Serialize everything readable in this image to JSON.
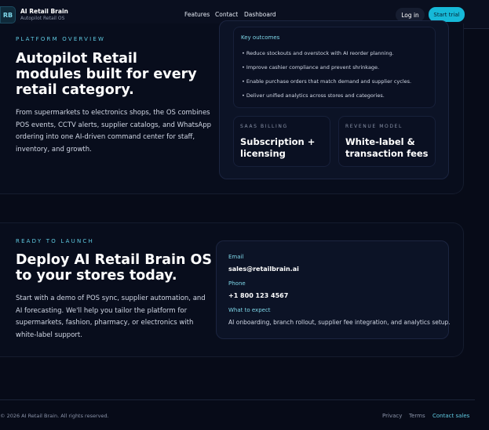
{
  "nav": {
    "logo": "RB",
    "brand_name": "AI Retail Brain",
    "brand_tag": "Autopilot Retail OS",
    "links": [
      "Features",
      "Contact",
      "Dashboard"
    ],
    "login": "Log in",
    "trial": "Start trial"
  },
  "overview": {
    "eyebrow": "PLATFORM OVERVIEW",
    "title": "Autopilot Retail modules built for every retail category.",
    "body": "From supermarkets to electronics shops, the OS combines POS events, CCTV alerts, supplier catalogs, and WhatsApp ordering into one AI-driven command center for staff, inventory, and growth.",
    "outcomes_title": "Key outcomes",
    "outcomes": [
      "• Reduce stockouts and overstock with AI reorder planning.",
      "• Improve cashier compliance and prevent shrinkage.",
      "• Enable purchase orders that match demand and supplier cycles.",
      "• Deliver unified analytics across stores and categories."
    ],
    "billing_label": "SAAS BILLING",
    "billing_value": "Subscription + licensing",
    "revenue_label": "REVENUE MODEL",
    "revenue_value": "White-label & transaction fees"
  },
  "launch": {
    "eyebrow": "READY TO LAUNCH",
    "title": "Deploy AI Retail Brain OS to your stores today.",
    "body": "Start with a demo of POS sync, supplier automation, and AI forecasting. We'll help you tailor the platform for supermarkets, fashion, pharmacy, or electronics with white-label support.",
    "email_label": "Email",
    "email": "sales@retailbrain.ai",
    "phone_label": "Phone",
    "phone": "+1 800 123 4567",
    "expect_label": "What to expect",
    "expect": "AI onboarding, branch rollout, supplier fee integration, and analytics setup."
  },
  "footer": {
    "copyright": "© 2026 AI Retail Brain. All rights reserved.",
    "privacy": "Privacy",
    "terms": "Terms",
    "contact": "Contact sales"
  },
  "colors": {
    "background": "#070b18",
    "accent": "#16b9d8",
    "eyebrow": "#5fc9e0"
  }
}
